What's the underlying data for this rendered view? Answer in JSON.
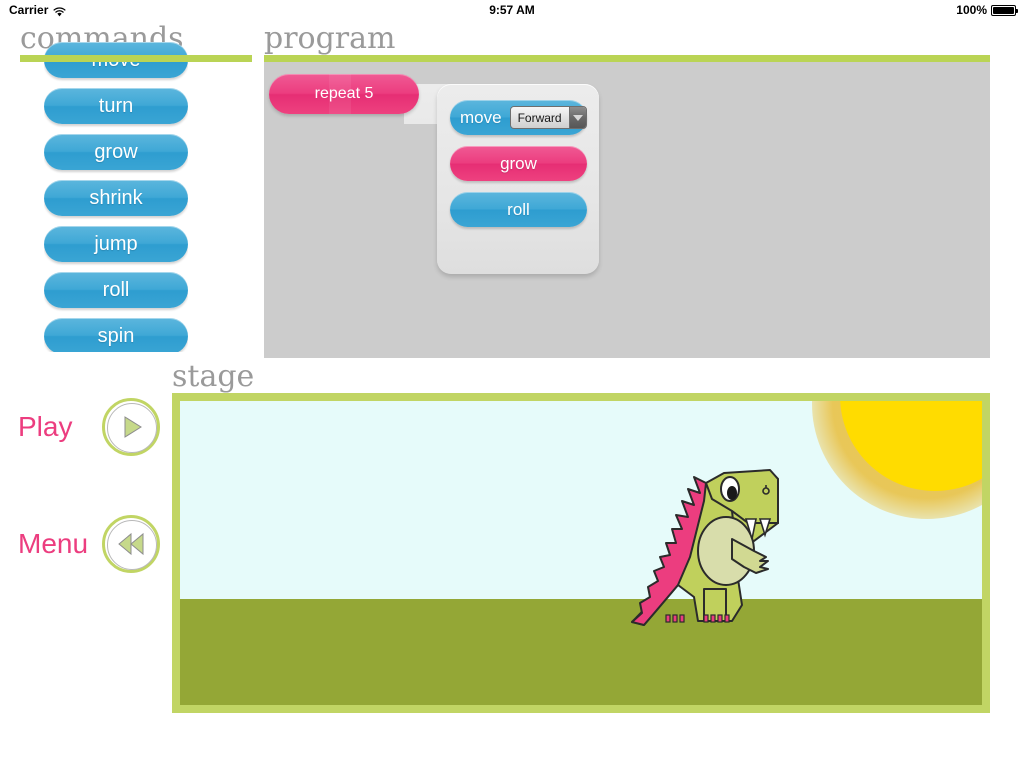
{
  "status_bar": {
    "carrier": "Carrier",
    "wifi_icon": "wifi-icon",
    "time": "9:57 AM",
    "battery_percent": "100%",
    "battery_icon": "battery-full-icon"
  },
  "commands": {
    "heading": "commands",
    "items": [
      {
        "label": "move",
        "color": "#3fa8d6",
        "partially_hidden": true
      },
      {
        "label": "turn",
        "color": "#3fa8d6"
      },
      {
        "label": "grow",
        "color": "#3fa8d6"
      },
      {
        "label": "shrink",
        "color": "#3fa8d6"
      },
      {
        "label": "jump",
        "color": "#3fa8d6"
      },
      {
        "label": "roll",
        "color": "#3fa8d6"
      },
      {
        "label": "spin",
        "color": "#3fa8d6"
      }
    ]
  },
  "program": {
    "heading": "program",
    "repeat_block": {
      "label": "repeat 5",
      "color": "#ec3d7f"
    },
    "body_blocks": [
      {
        "label": "move",
        "color": "#3fa8d6",
        "dropdown": {
          "value": "Forward",
          "arrow_icon": "chevron-down-icon"
        }
      },
      {
        "label": "grow",
        "color": "#ec3d7f"
      },
      {
        "label": "roll",
        "color": "#3fa8d6"
      }
    ]
  },
  "stage": {
    "heading": "stage",
    "sky_color": "#e6fbfa",
    "ground_color": "#94a736",
    "sun_color": "#ffdc00",
    "border_color": "#c1d564",
    "sprite": {
      "name": "dinosaur",
      "body_color": "#c0d05c",
      "spike_color": "#ec3d7f",
      "belly_color": "#d8ddab"
    }
  },
  "controls": {
    "play": {
      "label": "Play",
      "icon": "play-triangle-icon"
    },
    "menu": {
      "label": "Menu",
      "icon": "rewind-double-arrow-icon"
    },
    "label_color": "#ec3d7f",
    "ring_color": "#c1d564"
  },
  "theme": {
    "accent_green": "#bad455",
    "accent_pink": "#ec3d7f",
    "accent_blue": "#3fa8d6",
    "heading_gray": "#9a9a9a",
    "canvas_gray": "#cccccc"
  }
}
